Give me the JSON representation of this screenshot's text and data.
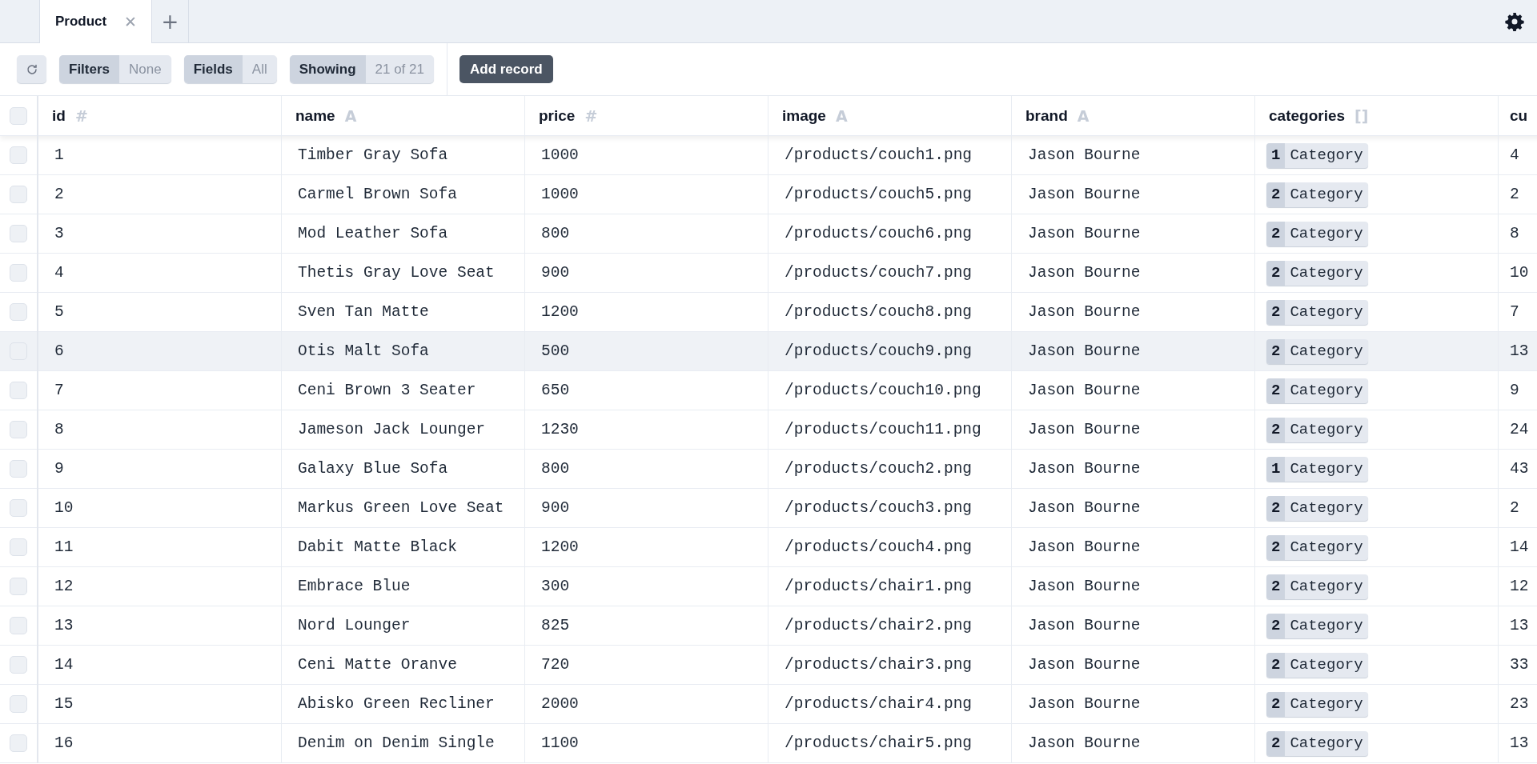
{
  "tabs": [
    {
      "label": "Product",
      "selected": true,
      "close": "✕"
    }
  ],
  "add_tab": "+",
  "toolbar": {
    "groups": [
      {
        "label": "Filters",
        "value": "None"
      },
      {
        "label": "Fields",
        "value": "All"
      },
      {
        "label": "Showing",
        "value": "21 of 21"
      }
    ],
    "add_button": "Add record"
  },
  "table": {
    "select_all_checked": false,
    "columns": [
      {
        "name": "id",
        "type_mark": "#"
      },
      {
        "name": "name",
        "type_mark": "A"
      },
      {
        "name": "price",
        "type_mark": "#"
      },
      {
        "name": "image",
        "type_mark": "A"
      },
      {
        "name": "brand",
        "type_mark": "A"
      },
      {
        "name": "categories",
        "type_mark": "[]"
      },
      {
        "name": "cu"
      }
    ],
    "rows": [
      {
        "checked": false,
        "hovered": false,
        "cells": [
          "1",
          "Timber Gray Sofa",
          "1000",
          "/products/couch1.png",
          "Jason Bourne",
          {
            "count": "1",
            "label": "Category"
          },
          "4"
        ]
      },
      {
        "checked": false,
        "hovered": false,
        "cells": [
          "2",
          "Carmel Brown Sofa",
          "1000",
          "/products/couch5.png",
          "Jason Bourne",
          {
            "count": "2",
            "label": "Category"
          },
          "2"
        ]
      },
      {
        "checked": false,
        "hovered": false,
        "cells": [
          "3",
          "Mod Leather Sofa",
          "800",
          "/products/couch6.png",
          "Jason Bourne",
          {
            "count": "2",
            "label": "Category"
          },
          "8"
        ]
      },
      {
        "checked": false,
        "hovered": false,
        "cells": [
          "4",
          "Thetis Gray Love Seat",
          "900",
          "/products/couch7.png",
          "Jason Bourne",
          {
            "count": "2",
            "label": "Category"
          },
          "10"
        ]
      },
      {
        "checked": false,
        "hovered": false,
        "cells": [
          "5",
          "Sven Tan Matte",
          "1200",
          "/products/couch8.png",
          "Jason Bourne",
          {
            "count": "2",
            "label": "Category"
          },
          "7"
        ]
      },
      {
        "checked": false,
        "hovered": true,
        "cells": [
          "6",
          "Otis Malt Sofa",
          "500",
          "/products/couch9.png",
          "Jason Bourne",
          {
            "count": "2",
            "label": "Category"
          },
          "13"
        ]
      },
      {
        "checked": false,
        "hovered": false,
        "cells": [
          "7",
          "Ceni Brown 3 Seater",
          "650",
          "/products/couch10.png",
          "Jason Bourne",
          {
            "count": "2",
            "label": "Category"
          },
          "9"
        ]
      },
      {
        "checked": false,
        "hovered": false,
        "cells": [
          "8",
          "Jameson Jack Lounger",
          "1230",
          "/products/couch11.png",
          "Jason Bourne",
          {
            "count": "2",
            "label": "Category"
          },
          "24"
        ]
      },
      {
        "checked": false,
        "hovered": false,
        "cells": [
          "9",
          "Galaxy Blue Sofa",
          "800",
          "/products/couch2.png",
          "Jason Bourne",
          {
            "count": "1",
            "label": "Category"
          },
          "43"
        ]
      },
      {
        "checked": false,
        "hovered": false,
        "cells": [
          "10",
          "Markus Green Love Seat",
          "900",
          "/products/couch3.png",
          "Jason Bourne",
          {
            "count": "2",
            "label": "Category"
          },
          "2"
        ]
      },
      {
        "checked": false,
        "hovered": false,
        "cells": [
          "11",
          "Dabit Matte Black",
          "1200",
          "/products/couch4.png",
          "Jason Bourne",
          {
            "count": "2",
            "label": "Category"
          },
          "14"
        ]
      },
      {
        "checked": false,
        "hovered": false,
        "cells": [
          "12",
          "Embrace Blue",
          "300",
          "/products/chair1.png",
          "Jason Bourne",
          {
            "count": "2",
            "label": "Category"
          },
          "12"
        ]
      },
      {
        "checked": false,
        "hovered": false,
        "cells": [
          "13",
          "Nord Lounger",
          "825",
          "/products/chair2.png",
          "Jason Bourne",
          {
            "count": "2",
            "label": "Category"
          },
          "13"
        ]
      },
      {
        "checked": false,
        "hovered": false,
        "cells": [
          "14",
          "Ceni Matte Oranve",
          "720",
          "/products/chair3.png",
          "Jason Bourne",
          {
            "count": "2",
            "label": "Category"
          },
          "33"
        ]
      },
      {
        "checked": false,
        "hovered": false,
        "cells": [
          "15",
          "Abisko Green Recliner",
          "2000",
          "/products/chair4.png",
          "Jason Bourne",
          {
            "count": "2",
            "label": "Category"
          },
          "23"
        ]
      },
      {
        "checked": false,
        "hovered": false,
        "cells": [
          "16",
          "Denim on Denim Single",
          "1100",
          "/products/chair5.png",
          "Jason Bourne",
          {
            "count": "2",
            "label": "Category"
          },
          "13"
        ]
      }
    ]
  }
}
